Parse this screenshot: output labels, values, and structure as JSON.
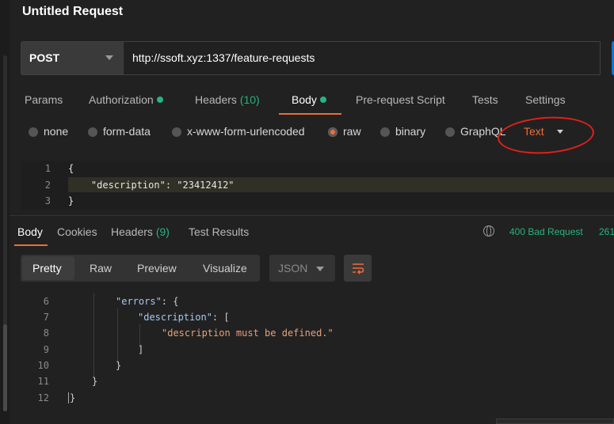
{
  "window": {
    "title": "Untitled Request"
  },
  "request": {
    "method": "POST",
    "url": "http://ssoft.xyz:1337/feature-requests"
  },
  "request_tabs": [
    {
      "label": "Params"
    },
    {
      "label": "Authorization"
    },
    {
      "label": "Headers",
      "count": "(10)"
    },
    {
      "label": "Body"
    },
    {
      "label": "Pre-request Script"
    },
    {
      "label": "Tests"
    },
    {
      "label": "Settings"
    }
  ],
  "body_modes": [
    {
      "label": "none",
      "selected": false
    },
    {
      "label": "form-data",
      "selected": false
    },
    {
      "label": "x-www-form-urlencoded",
      "selected": false
    },
    {
      "label": "raw",
      "selected": true
    },
    {
      "label": "binary",
      "selected": false
    },
    {
      "label": "GraphQL",
      "selected": false
    }
  ],
  "raw_type": "Text",
  "request_body": {
    "line_numbers": [
      "1",
      "2",
      "3"
    ],
    "lines": [
      "{",
      "    \"description\": \"23412412\"",
      "}"
    ]
  },
  "response_tabs": [
    {
      "label": "Body"
    },
    {
      "label": "Cookies"
    },
    {
      "label": "Headers",
      "count": "(9)"
    },
    {
      "label": "Test Results"
    }
  ],
  "response_status": {
    "status": "400 Bad Request",
    "time": "261"
  },
  "view_modes": [
    "Pretty",
    "Raw",
    "Preview",
    "Visualize"
  ],
  "format": "JSON",
  "response_body": {
    "line_numbers": [
      "6",
      "7",
      "8",
      "9",
      "10",
      "11",
      "12"
    ],
    "errors_key": "\"errors\"",
    "description_key": "\"description\"",
    "message": "\"description must be defined.\""
  },
  "colors": {
    "accent": "#f26b3a",
    "success": "#26b47f",
    "annotation": "#e0201a"
  }
}
